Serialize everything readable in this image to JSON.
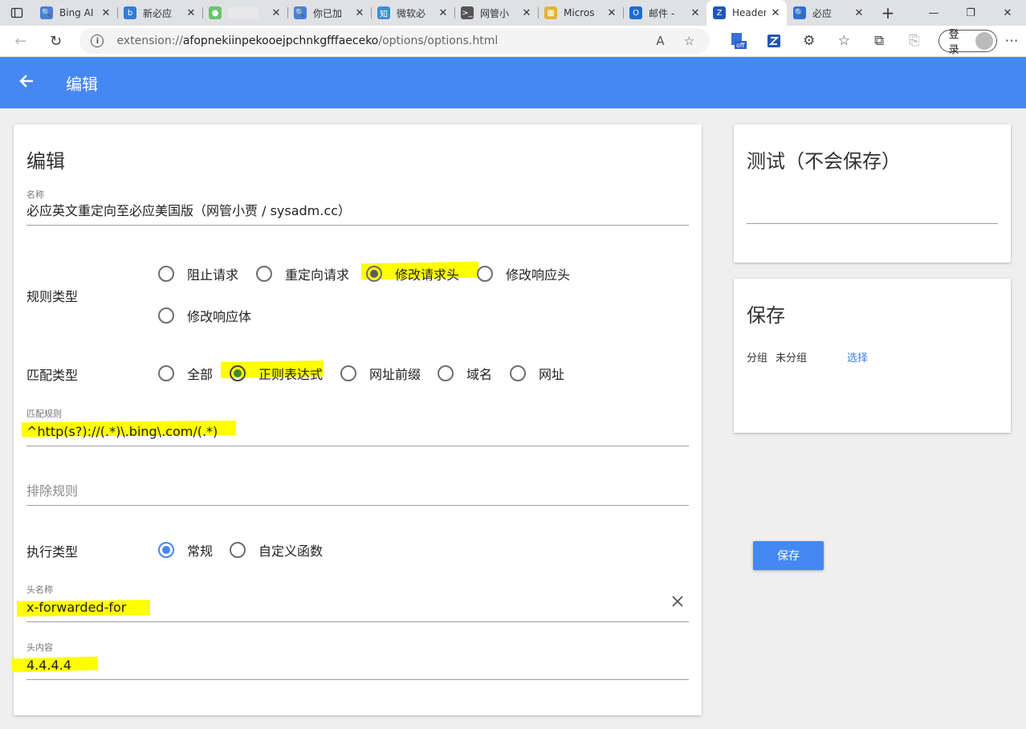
{
  "browser": {
    "tabs": [
      {
        "title": "Bing AI",
        "fav_color": "#4a7fd8",
        "fav_glyph": "🔍"
      },
      {
        "title": "新必应",
        "fav_color": "#2f7dd8",
        "fav_glyph": "b"
      },
      {
        "title": "",
        "fav_color": "#6dc26d",
        "fav_glyph": "●"
      },
      {
        "title": "你已加",
        "fav_color": "#4a7fd8",
        "fav_glyph": "🔍"
      },
      {
        "title": "微软必",
        "fav_color": "#3b8ed8",
        "fav_glyph": "知"
      },
      {
        "title": "网管小",
        "fav_color": "#555555",
        "fav_glyph": ">_"
      },
      {
        "title": "Micros",
        "fav_color": "#e2b33a",
        "fav_glyph": "▦"
      },
      {
        "title": "邮件 -",
        "fav_color": "#1b6ed0",
        "fav_glyph": "O"
      },
      {
        "title": "Header",
        "fav_color": "#2356b8",
        "fav_glyph": "Z",
        "active": true
      },
      {
        "title": "必应",
        "fav_color": "#2f6fd8",
        "fav_glyph": "🔍"
      }
    ],
    "new_tab": "+",
    "url_prefix": "extension://",
    "url_host": "afopnekiinpekooejpchnkgfffaeceko",
    "url_path": "/options/options.html",
    "login_label": "登录"
  },
  "appbar": {
    "title": "编辑"
  },
  "editor": {
    "heading": "编辑",
    "name_label": "名称",
    "name_value": "必应英文重定向至必应美国版（网管小贾 / sysadm.cc）",
    "rule_type_label": "规则类型",
    "rule_type_options": [
      "阻止请求",
      "重定向请求",
      "修改请求头",
      "修改响应头",
      "修改响应体"
    ],
    "rule_type_selected": "修改请求头",
    "match_type_label": "匹配类型",
    "match_type_options": [
      "全部",
      "正则表达式",
      "网址前缀",
      "域名",
      "网址"
    ],
    "match_type_selected": "正则表达式",
    "match_rule_label": "匹配规则",
    "match_rule_value": "^http(s?)://(.*)\\.bing\\.com/(.*)",
    "exclude_placeholder": "排除规则",
    "exec_type_label": "执行类型",
    "exec_type_options": [
      "常规",
      "自定义函数"
    ],
    "exec_type_selected": "常规",
    "header_name_label": "头名称",
    "header_name_value": "x-forwarded-for",
    "header_value_label": "头内容",
    "header_value_value": "4.4.4.4"
  },
  "test_card": {
    "heading": "测试（不会保存）"
  },
  "save_card": {
    "heading": "保存",
    "group_label": "分组",
    "group_value": "未分组",
    "select_link": "选择",
    "save_button": "保存"
  },
  "colors": {
    "accent": "#4688f1",
    "highlight": "#fffe00"
  }
}
